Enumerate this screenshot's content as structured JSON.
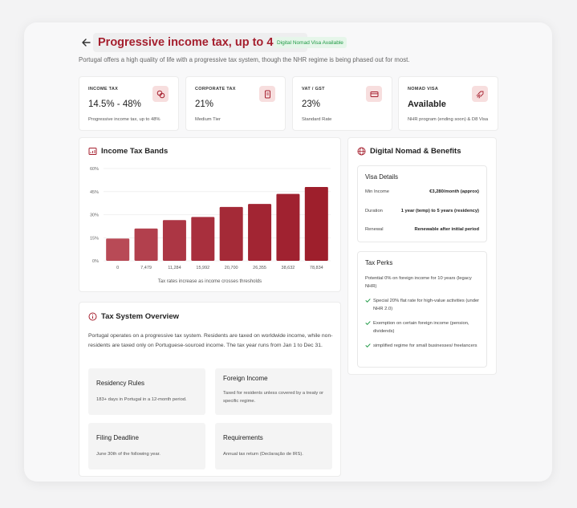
{
  "header": {
    "title": "Progressive income tax, up to 48%",
    "visa_badge": "Digital Nomad Visa Available",
    "intro": "Portugal offers a high quality of life with a progressive tax system, though the NHR regime is being phased out for most."
  },
  "stats": [
    {
      "label": "INCOME TAX",
      "value": "14.5% - 48%",
      "sub": "Progressive income tax, up to 48%",
      "icon": "coins-icon"
    },
    {
      "label": "CORPORATE TAX",
      "value": "21%",
      "sub": "Medium Tier",
      "icon": "receipt-icon"
    },
    {
      "label": "VAT / GST",
      "value": "23%",
      "sub": "Standard Rate",
      "icon": "card-icon"
    },
    {
      "label": "NOMAD VISA",
      "value": "Available",
      "sub": "NHR program (ending soon) & D8 Visa",
      "icon": "plane-icon"
    }
  ],
  "chart_section": {
    "title": "Income Tax Bands",
    "caption": "Tax rates increase as income crosses thresholds"
  },
  "chart_data": {
    "type": "bar",
    "categories": [
      "0",
      "7,479",
      "11,284",
      "15,992",
      "20,700",
      "26,355",
      "38,632",
      "78,834"
    ],
    "values": [
      14.5,
      21,
      26.5,
      28.5,
      35,
      37,
      43.5,
      48
    ],
    "ylim": [
      0,
      60
    ],
    "yticks": [
      "0%",
      "15%",
      "30%",
      "45%",
      "60%"
    ],
    "grid": true,
    "colors": [
      "#b84a56",
      "#b2404d",
      "#ac3644",
      "#a82f3d",
      "#a42a37",
      "#a22533",
      "#a02230",
      "#9e1f2c"
    ]
  },
  "overview": {
    "title": "Tax System Overview",
    "text": "Portugal operates on a progressive tax system. Residents are taxed on worldwide income, while non-residents are taxed only on Portuguese-sourced income. The tax year runs from Jan 1 to Dec 31.",
    "tiles": [
      {
        "title": "Residency Rules",
        "desc": "183+ days in Portugal in a 12-month period."
      },
      {
        "title": "Foreign Income",
        "desc": "Taxed for residents unless covered by a treaty or specific regime."
      },
      {
        "title": "Filing Deadline",
        "desc": "June 30th of the following year."
      },
      {
        "title": "Requirements",
        "desc": "Annual tax return (Declaração de IRS)."
      }
    ]
  },
  "nomad": {
    "title": "Digital Nomad & Benefits",
    "visa_title": "Visa Details",
    "visa_rows": [
      {
        "k": "Min Income",
        "v": "€3,280/month (approx)"
      },
      {
        "k": "Duration",
        "v": "1 year (temp) to 5 years (residency)"
      },
      {
        "k": "Renewal",
        "v": "Renewable after initial period"
      }
    ],
    "perks_title": "Tax Perks",
    "perks_intro": "Potential 0% on foreign income for 10 years (legacy NHR)",
    "perks": [
      "Special 20% flat rate for high-value activities (under NHR 2.0)",
      "Exemption on certain foreign income (pension, dividends)",
      "simplified regime for small businesses/ freelancers"
    ]
  },
  "colors": {
    "accent": "#a51f2e",
    "accent_soft": "#f7dede",
    "success": "#1f9a45"
  }
}
